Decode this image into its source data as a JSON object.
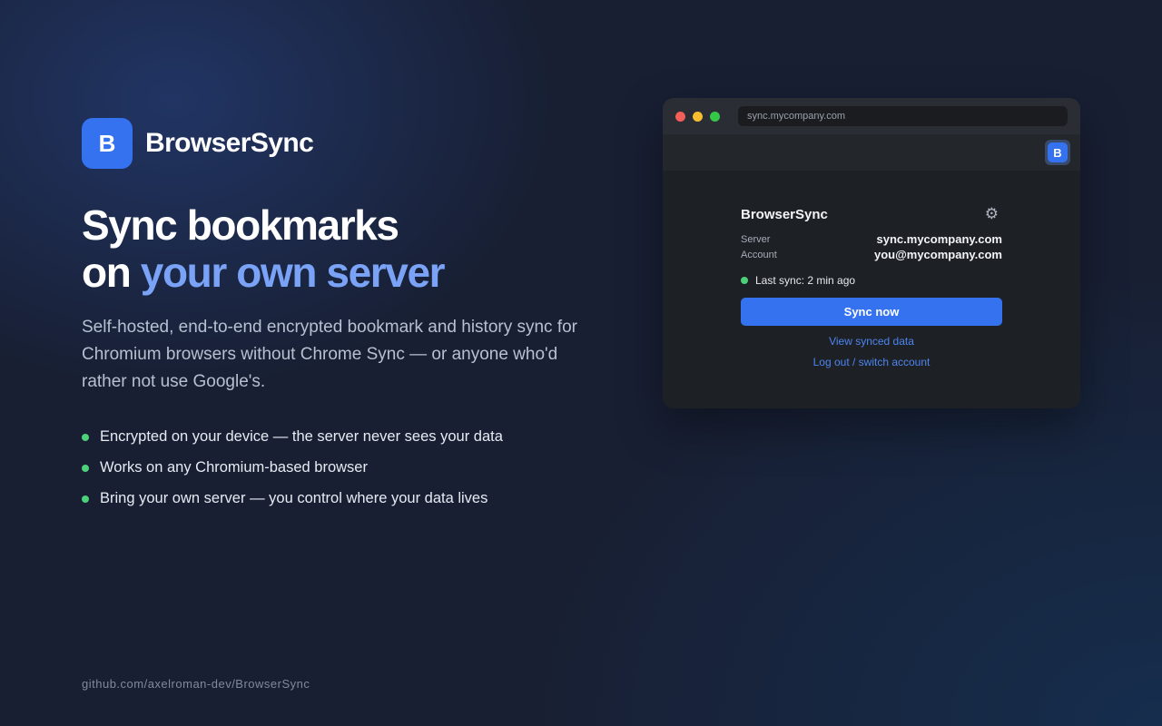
{
  "brand": {
    "logo_letter": "B",
    "name": "BrowserSync",
    "accent_color": "#3572f0"
  },
  "headline": {
    "line1": "Sync bookmarks",
    "line2_prefix": "on ",
    "line2_accent": "your own server"
  },
  "description": "Self-hosted, end-to-end encrypted bookmark and history sync for Chromium browsers without Chrome Sync — or anyone who'd rather not use Google's.",
  "features": [
    "Encrypted on your device — the server never sees your data",
    "Works on any Chromium-based browser",
    "Bring your own server — you control where your data lives"
  ],
  "repo_url": "github.com/axelroman-dev/BrowserSync",
  "browser": {
    "url": "sync.mycompany.com",
    "extension_letter": "B",
    "popup": {
      "title": "BrowserSync",
      "settings_icon": "gear-icon",
      "server_label": "Server",
      "server_value": "sync.mycompany.com",
      "account_label": "Account",
      "account_value": "you@mycompany.com",
      "status_text": "Last sync: 2 min ago",
      "status_color": "#4cd07a",
      "sync_button": "Sync now",
      "view_link": "View synced data",
      "logout_link": "Log out / switch account"
    }
  }
}
